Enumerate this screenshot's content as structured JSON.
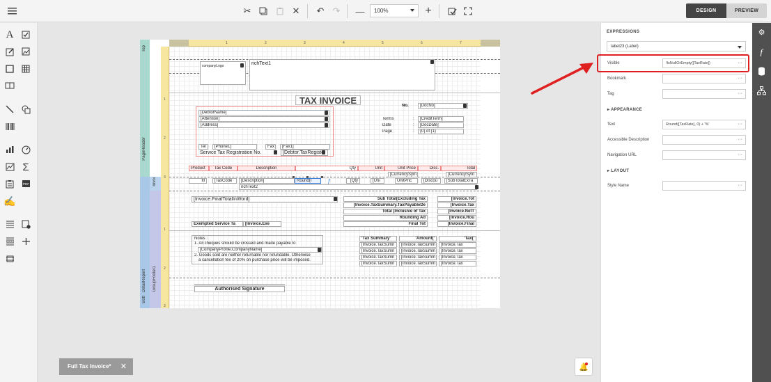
{
  "toolbar": {
    "zoom": "100%",
    "design_label": "DESIGN",
    "preview_label": "PREVIEW"
  },
  "report": {
    "bands": {
      "top": "Top",
      "page_header": "PageHeader",
      "invoice": "Invoi",
      "detail_report": "DetailReport",
      "group_footer": "GroupFooter1",
      "bottom": "Bott"
    },
    "ruler_top": [
      "1",
      "2",
      "3",
      "4",
      "5",
      "6",
      "7"
    ],
    "ruler_left": [
      "1",
      "2",
      "3",
      "1",
      "2",
      "3"
    ],
    "header": {
      "company_logo": "companyLogo",
      "rich_text": "richText1",
      "title": "TAX INVOICE",
      "no_label": "No.",
      "doc_no": "[DocNo]",
      "debtor_name": "[DebtorName]",
      "attention": "[Attention]",
      "address": "[Address]",
      "terms_label": "Terms",
      "date_label": "Date",
      "page_label": "Page",
      "colon": ":",
      "credit_term": "[CreditTerm]",
      "doc_date": "[DocDate]",
      "page_info": "{0} of {1}",
      "tel_label": "Tel",
      "phone": "[Phone1]",
      "fax_label": "Fax",
      "fax": "[Fax1]",
      "service_tax_label": "Service Tax Registration No.",
      "debtor_tax_reg": "[Debtor.TaxRegiste"
    },
    "columns": [
      "Product",
      "Tax Code",
      "Description",
      "Qty",
      "Unit",
      "Unit Price",
      "Disc.",
      "Total"
    ],
    "currency_symbol": "[CurrencySym",
    "detail_row": {
      "item": "Itl",
      "tax_code": "[TaxCode",
      "description": "[Description]",
      "round_label": "Round(I",
      "qty": "[Qty",
      "unit": "[Uni",
      "unit_price": "UnitPric",
      "discount": "[Discou",
      "subtotal": "[SubTotalExTa"
    },
    "rich_text2": "richText2",
    "footer": {
      "total_in_word": "[Invoice.FinalTotalInWord]",
      "subtotal_excl": "Sub Total(Excluding Tax",
      "tax_payable": "[Invoice.TaxSummary.TaxPayableDe",
      "total_incl": "Total (Inclusive of Tax",
      "rounding": "Rounding Ad",
      "final_total": "Final Tot",
      "v1": "[Invoice.Tot",
      "v2": "[Invoice.Tax",
      "v3": "[Invoice.NetT",
      "v4": "[Invoice.Rou",
      "v5": "[Invoice.Final",
      "exempted_label": "Exempted Service Ta",
      "exempted_value": "[Invoice.Exe",
      "notes_title": "Notes :",
      "note1": "1. All cheques should be crossed and made payable to",
      "company_profile": "[CompanyProfile.CompanyName]",
      "note2a": "2. Goods sold are neither returnable nor refundable. Otherwise",
      "note2b": "a cancellation fee of 20% on purchase price will be imposed.",
      "tax_summary_hdr": "'Tax Summary'",
      "amount_hdr": "'Amount('",
      "tax_hdr": "'Tax('",
      "summary_cell_a": "[Invoice.TaxSumn",
      "summary_cell_b": "[Invoice.TaxSumm",
      "summary_cell_c": "[Invoice.Tax",
      "signature": "Authorised Signature"
    }
  },
  "panel": {
    "title": "EXPRESSIONS",
    "selected": "label23 (Label)",
    "visible_label": "Visible",
    "visible_value": "!IsNullOrEmpty([TaxRate])",
    "bookmark_label": "Bookmark",
    "tag_label": "Tag",
    "appearance_label": "APPEARANCE",
    "text_label": "Text",
    "text_value": "Round([TaxRate], 0) + '%'",
    "accessible_label": "Accessible Description",
    "nav_url_label": "Navigation URL",
    "layout_label": "LAYOUT",
    "style_name_label": "Style Name",
    "dots": "···"
  },
  "document_tab": {
    "label": "Full Tax Invoice*",
    "close": "✕"
  },
  "colors": {
    "highlight": "#e02020",
    "band_top": "#a9d8cf",
    "band_detail": "#a9c7e6",
    "ruler": "#f7e6a0",
    "rail": "#505050"
  }
}
